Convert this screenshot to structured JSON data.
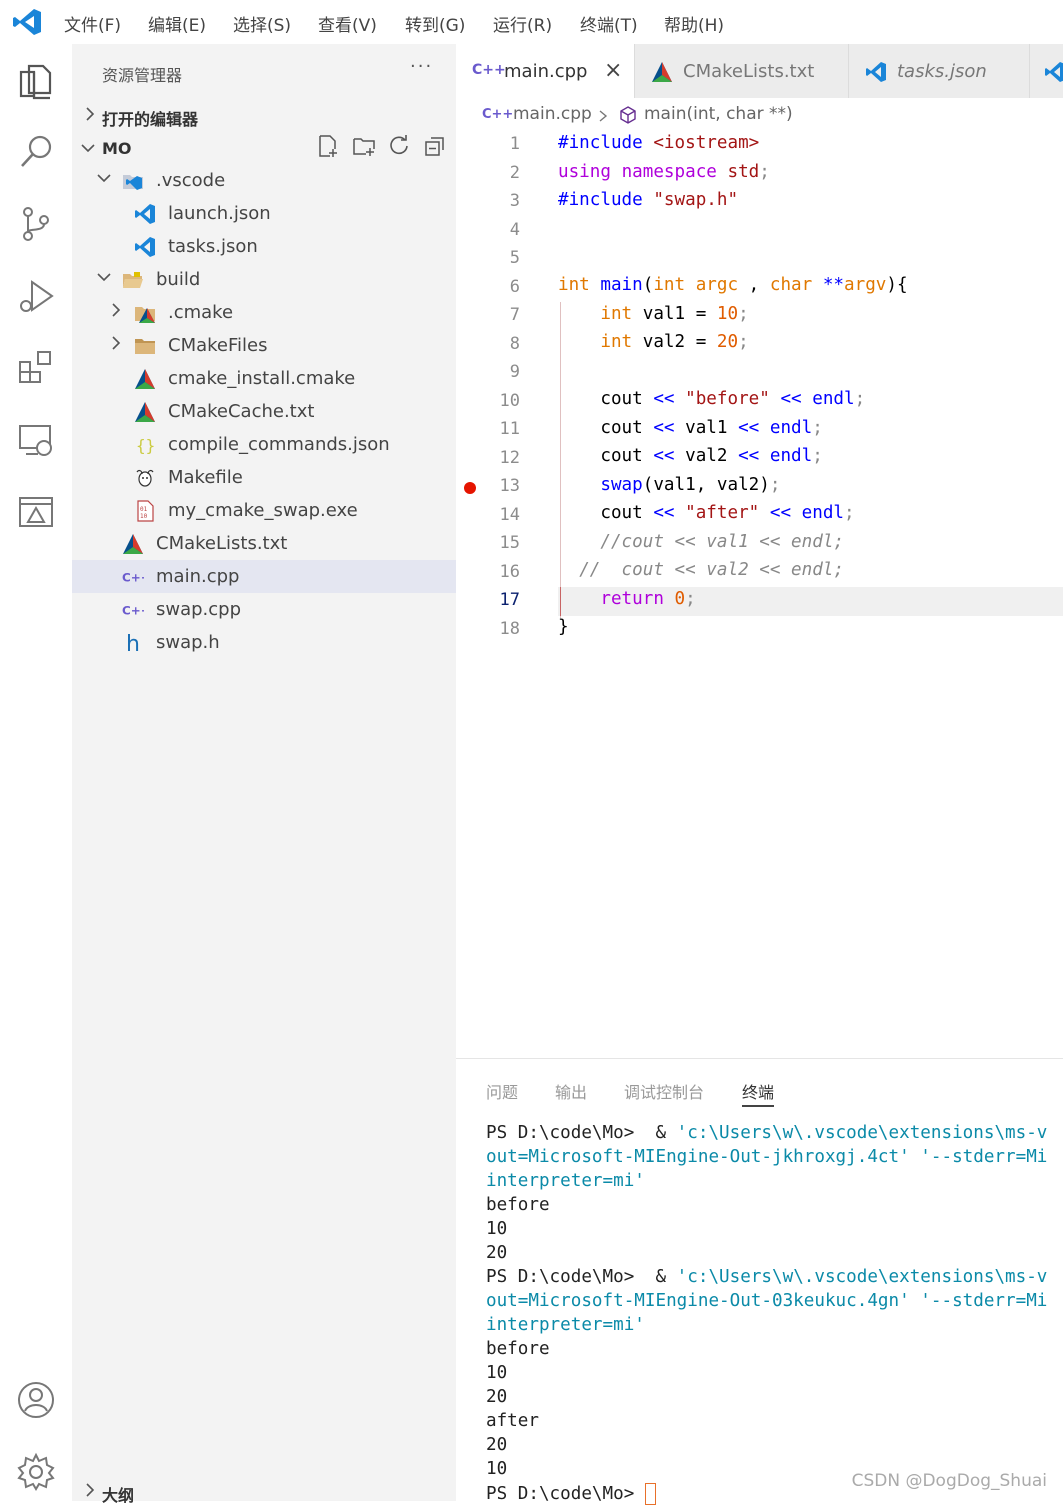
{
  "menu": [
    "文件(F)",
    "编辑(E)",
    "选择(S)",
    "查看(V)",
    "转到(G)",
    "运行(R)",
    "终端(T)",
    "帮助(H)"
  ],
  "sidebar": {
    "title": "资源管理器",
    "more": "···",
    "open_editors": "打开的编辑器",
    "folder": "MO",
    "outline": "大纲",
    "tree": [
      {
        "label": ".vscode",
        "icon": "vscode-folder-icon",
        "depth": 1,
        "chevron": "open"
      },
      {
        "label": "launch.json",
        "icon": "vscode-file-icon",
        "depth": 2
      },
      {
        "label": "tasks.json",
        "icon": "vscode-file-icon",
        "depth": 2
      },
      {
        "label": "build",
        "icon": "folder-open-icon",
        "depth": 1,
        "chevron": "open"
      },
      {
        "label": ".cmake",
        "icon": "cmake-folder-icon",
        "depth": 2,
        "chevron": "closed"
      },
      {
        "label": "CMakeFiles",
        "icon": "folder-icon",
        "depth": 2,
        "chevron": "closed"
      },
      {
        "label": "cmake_install.cmake",
        "icon": "cmake-icon",
        "depth": 2
      },
      {
        "label": "CMakeCache.txt",
        "icon": "cmake-icon",
        "depth": 2
      },
      {
        "label": "compile_commands.json",
        "icon": "json-braces-icon",
        "depth": 2
      },
      {
        "label": "Makefile",
        "icon": "gnu-icon",
        "depth": 2
      },
      {
        "label": "my_cmake_swap.exe",
        "icon": "binary-file-icon",
        "depth": 2
      },
      {
        "label": "CMakeLists.txt",
        "icon": "cmake-icon",
        "depth": 1
      },
      {
        "label": "main.cpp",
        "icon": "cpp-icon",
        "depth": 1,
        "active": true
      },
      {
        "label": "swap.cpp",
        "icon": "cpp-icon",
        "depth": 1
      },
      {
        "label": "swap.h",
        "icon": "header-h-icon",
        "depth": 1
      }
    ]
  },
  "tabs": [
    {
      "label": "main.cpp",
      "icon": "cpp-icon",
      "active": true,
      "close": "×"
    },
    {
      "label": "CMakeLists.txt",
      "icon": "cmake-icon"
    },
    {
      "label": "tasks.json",
      "icon": "vscode-file-icon",
      "italic": true
    }
  ],
  "breadcrumb": {
    "file": "main.cpp",
    "symbol": "main(int, char **)"
  },
  "code": {
    "line_numbers": [
      "1",
      "2",
      "3",
      "4",
      "5",
      "6",
      "7",
      "8",
      "9",
      "10",
      "11",
      "12",
      "13",
      "14",
      "15",
      "16",
      "17",
      "18"
    ],
    "current_line": 17,
    "breakpoint_line": 13
  },
  "panel": {
    "tabs": [
      "问题",
      "输出",
      "调试控制台",
      "终端"
    ],
    "active_tab": "终端",
    "terminal": [
      {
        "prompt": "PS D:\\code\\Mo>",
        "cmd": "  & 'c:\\Users\\w\\.vscode\\extensions\\ms-v"
      },
      {
        "cy": "out=Microsoft-MIEngine-Out-jkhroxgj.4ct' '--stderr=Mi"
      },
      {
        "cy": "interpreter=mi'"
      },
      {
        "text": "before"
      },
      {
        "text": "10"
      },
      {
        "text": "20"
      },
      {
        "prompt": "PS D:\\code\\Mo>",
        "cmd": "  & 'c:\\Users\\w\\.vscode\\extensions\\ms-v"
      },
      {
        "cy": "out=Microsoft-MIEngine-Out-03keukuc.4gn' '--stderr=Mi"
      },
      {
        "cy": "interpreter=mi'"
      },
      {
        "text": "before"
      },
      {
        "text": "10"
      },
      {
        "text": "20"
      },
      {
        "text": "after"
      },
      {
        "text": "20"
      },
      {
        "text": "10"
      },
      {
        "prompt": "PS D:\\code\\Mo>",
        "cmd": " "
      }
    ]
  },
  "watermark": "CSDN @DogDog_Shuai"
}
